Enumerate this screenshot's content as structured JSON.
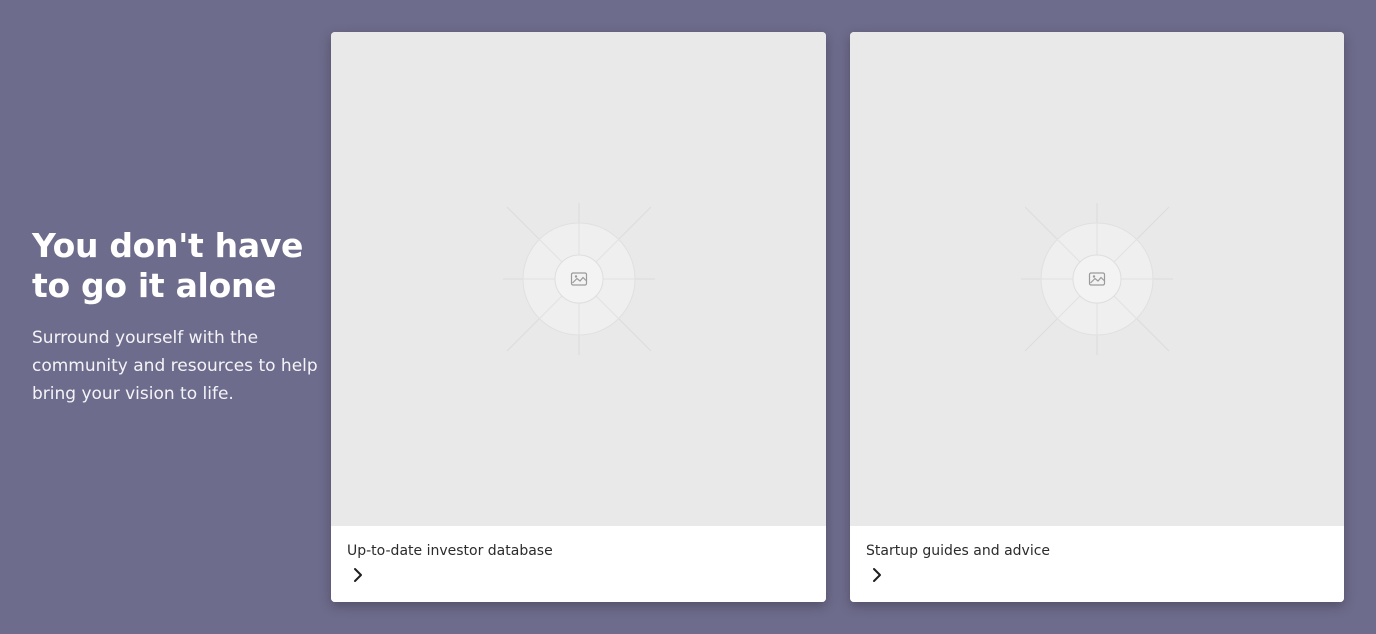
{
  "section": {
    "heading": "You don't have to go it alone",
    "description": "Surround yourself with the community and resources to help bring your vision to life."
  },
  "cards": [
    {
      "title": "Up-to-date investor database",
      "image_icon": "image-placeholder-icon",
      "arrow_icon": "chevron-right-icon"
    },
    {
      "title": "Startup guides and advice",
      "image_icon": "image-placeholder-icon",
      "arrow_icon": "chevron-right-icon"
    }
  ],
  "colors": {
    "background": "#6e6c8c",
    "card_media": "#e9e9e9",
    "card_footer": "#ffffff",
    "heading_text": "#ffffff",
    "card_title_text": "#2b2b2b"
  }
}
